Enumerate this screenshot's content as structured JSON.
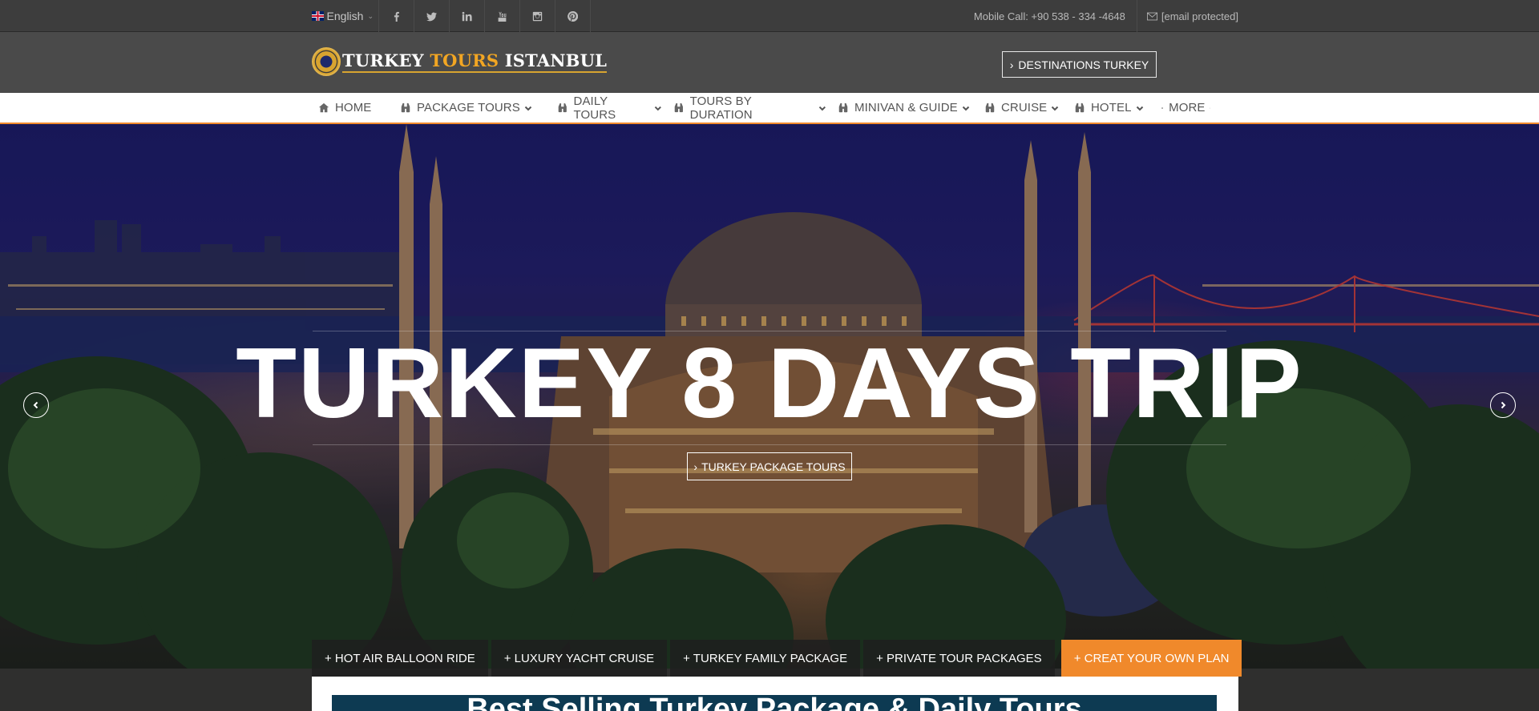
{
  "topbar": {
    "language": "English",
    "social_icons": [
      "facebook-icon",
      "twitter-icon",
      "linkedin-icon",
      "youtube-icon",
      "instagram-icon",
      "pinterest-icon"
    ],
    "mobile_call": "Mobile Call:  +90 538 - 334 -4648",
    "email": "[email protected]"
  },
  "header": {
    "logo": {
      "part1": "TURKEY ",
      "part2": "TOURS",
      "part3": " ISTANBUL"
    },
    "destinations_button": "DESTINATIONS TURKEY"
  },
  "nav": {
    "items": [
      {
        "label": "HOME",
        "icon": "home-icon"
      },
      {
        "label": "PACKAGE TOURS",
        "icon": "binoculars-icon"
      },
      {
        "label": "DAILY TOURS",
        "icon": "binoculars-icon"
      },
      {
        "label": "TOURS BY DURATION",
        "icon": "binoculars-icon"
      },
      {
        "label": "MINIVAN & GUIDE",
        "icon": "binoculars-icon"
      },
      {
        "label": "CRUISE",
        "icon": "binoculars-icon"
      },
      {
        "label": "HOTEL",
        "icon": "binoculars-icon"
      },
      {
        "label": "MORE",
        "icon": "binoculars-icon"
      }
    ]
  },
  "hero": {
    "title": "TURKEY 8 DAYS TRIP",
    "button": "TURKEY PACKAGE TOURS"
  },
  "tabs": [
    "+ HOT AIR BALLOON RIDE",
    "+ LUXURY YACHT CRUISE",
    "+ TURKEY FAMILY PACKAGE",
    "+ PRIVATE TOUR PACKAGES",
    "+ CREAT YOUR OWN PLAN"
  ],
  "content": {
    "banner_title": "Best Selling Turkey Package & Daily Tours"
  },
  "colors": {
    "accent": "#f0892b",
    "topbar": "#3d3d3d",
    "header": "#4a4a4a",
    "banner": "#0d3a52"
  }
}
